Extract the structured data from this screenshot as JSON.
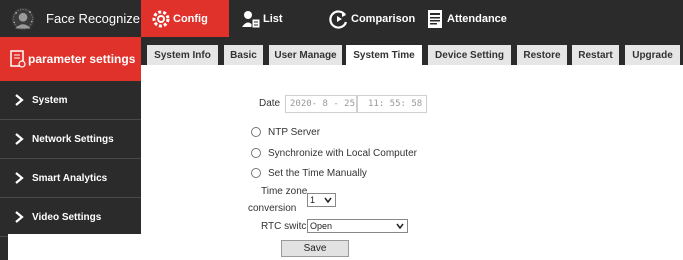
{
  "header": {
    "app_title": "Face Recognize",
    "nav": [
      {
        "label": "Config",
        "icon": "gear-icon",
        "active": true
      },
      {
        "label": "List",
        "icon": "user-list-icon",
        "active": false
      },
      {
        "label": "Comparison",
        "icon": "compare-icon",
        "active": false
      },
      {
        "label": "Attendance",
        "icon": "document-icon",
        "active": false
      }
    ]
  },
  "sidebar": {
    "header_label": "parameter settings",
    "items": [
      {
        "label": "System"
      },
      {
        "label": "Network Settings"
      },
      {
        "label": "Smart Analytics"
      },
      {
        "label": "Video Settings"
      }
    ]
  },
  "tabs": [
    {
      "label": "System Info",
      "active": false
    },
    {
      "label": "Basic",
      "active": false
    },
    {
      "label": "User Manage",
      "active": false
    },
    {
      "label": "System Time",
      "active": true
    },
    {
      "label": "Device Setting",
      "active": false
    },
    {
      "label": "Restore",
      "active": false
    },
    {
      "label": "Restart",
      "active": false
    },
    {
      "label": "Upgrade",
      "active": false
    }
  ],
  "form": {
    "date_label": "Date",
    "date_value": "2020- 8 - 25",
    "time_value": "11: 55: 58",
    "radio_options": [
      {
        "label": "NTP Server",
        "selected": false
      },
      {
        "label": "Synchronize with Local Computer",
        "selected": false
      },
      {
        "label": "Set the Time Manually",
        "selected": false
      }
    ],
    "timezone_label_line1": "Time zone",
    "timezone_label_line2": "conversion",
    "timezone_value": "1",
    "rtc_label": "RTC switch",
    "rtc_value": "Open",
    "save_label": "Save"
  },
  "colors": {
    "accent": "#e0312a",
    "dark_bg": "#2b2b2b",
    "tab_bg": "#e6e6e6"
  }
}
